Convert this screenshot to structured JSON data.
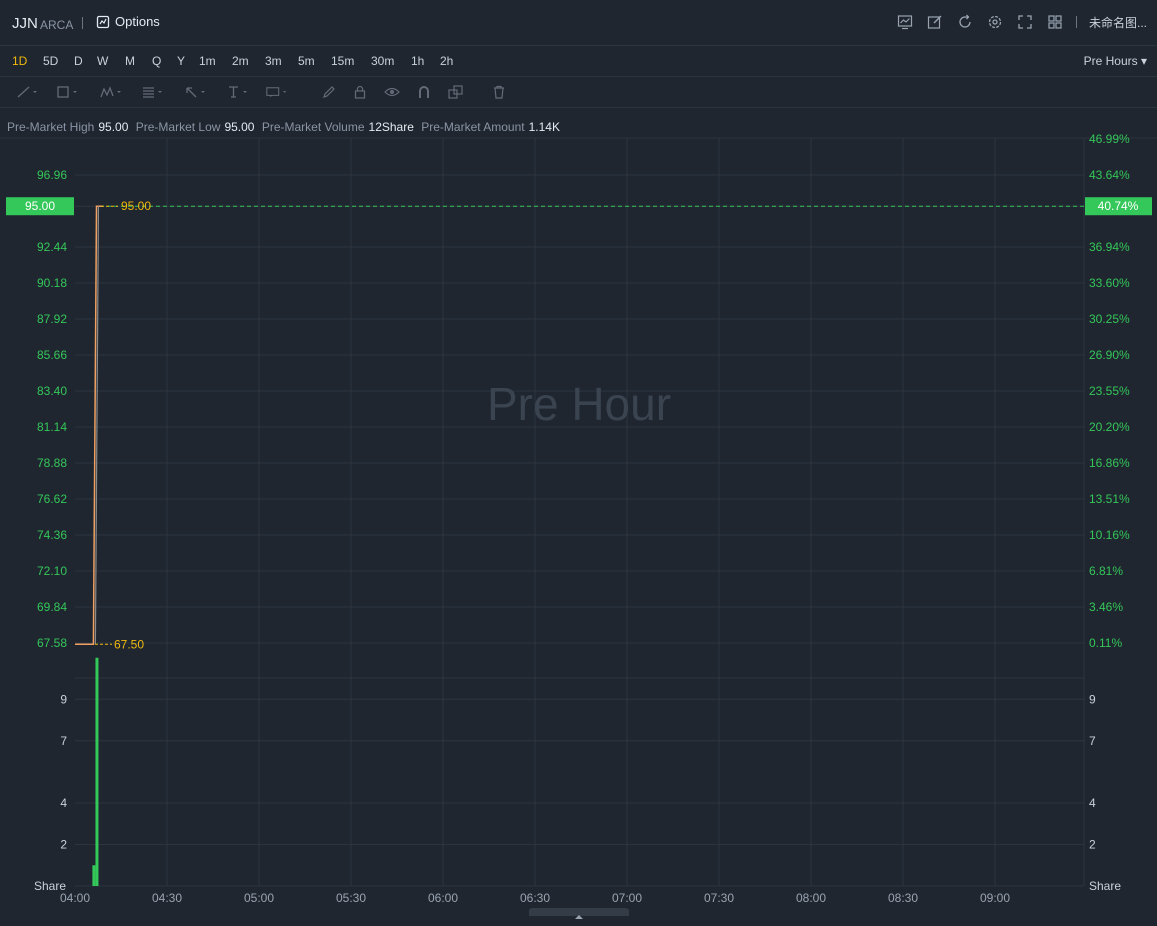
{
  "header": {
    "symbol": "JJN",
    "exchange": "ARCA",
    "options_label": "Options",
    "layout_name": "未命名图...",
    "icons": [
      "indicator-icon",
      "draw-icon",
      "refresh-icon",
      "settings-icon",
      "fullscreen-icon",
      "layout-grid-icon"
    ]
  },
  "intervals": {
    "items": [
      "1D",
      "5D",
      "D",
      "W",
      "M",
      "Q",
      "Y",
      "1m",
      "2m",
      "3m",
      "5m",
      "15m",
      "30m",
      "1h",
      "2h"
    ],
    "active": "1D",
    "session_label": "Pre Hours"
  },
  "drawing_tools": [
    "line-tool-icon",
    "rectangle-tool-icon",
    "pattern-tool-icon",
    "fib-tool-icon",
    "arrow-tool-icon",
    "text-tool-icon",
    "annotation-tool-icon",
    "pencil-icon",
    "lock-icon",
    "eye-icon",
    "magnet-icon",
    "copy-icon",
    "trash-icon"
  ],
  "stats": {
    "high_label": "Pre-Market High",
    "high_value": "95.00",
    "low_label": "Pre-Market Low",
    "low_value": "95.00",
    "volume_label": "Pre-Market Volume",
    "volume_value": "12Share",
    "amount_label": "Pre-Market Amount",
    "amount_value": "1.14K"
  },
  "colors": {
    "background": "#1f2630",
    "grid": "#2b3540",
    "up_green": "#34c759",
    "price_line": "#f0a060",
    "label_yellow": "#f0b90b",
    "watermark": "#3a4350"
  },
  "chart_data": [
    {
      "type": "line",
      "watermark": "Pre Hour",
      "x_ticks": [
        "04:00",
        "04:30",
        "05:00",
        "05:30",
        "06:00",
        "06:30",
        "07:00",
        "07:30",
        "08:00",
        "08:30",
        "09:00"
      ],
      "y_ticks": [
        96.96,
        92.44,
        90.18,
        87.92,
        85.66,
        83.4,
        81.14,
        78.88,
        76.62,
        74.36,
        72.1,
        69.84,
        67.58
      ],
      "y_ticks_percent": [
        "46.99%",
        "43.64%",
        "36.94%",
        "33.60%",
        "30.25%",
        "26.90%",
        "23.55%",
        "20.20%",
        "16.86%",
        "13.51%",
        "10.16%",
        "6.81%",
        "3.46%",
        "0.11%"
      ],
      "current_price_label": "95.00",
      "current_percent_label": "40.74%",
      "annotations": [
        "95.00",
        "67.50"
      ],
      "ylim": [
        67.5,
        98.2
      ],
      "series": [
        {
          "x": [
            "04:00",
            "04:05",
            "04:06",
            "04:07",
            "04:09"
          ],
          "values": [
            67.5,
            67.5,
            67.5,
            95.0,
            95.0
          ]
        }
      ]
    },
    {
      "type": "bar",
      "ylabel": "Share",
      "y_ticks": [
        9,
        7,
        4,
        2
      ],
      "ylim": [
        0,
        10
      ],
      "x": [
        "04:06",
        "04:07"
      ],
      "values": [
        1,
        11
      ]
    }
  ]
}
